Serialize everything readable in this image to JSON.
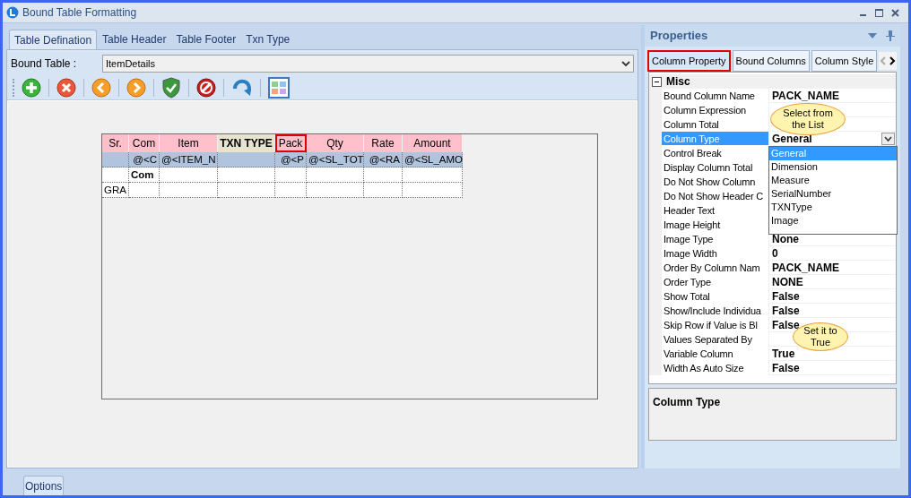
{
  "window": {
    "title": "Bound Table Formatting"
  },
  "tabs": [
    {
      "label": "Table Defination",
      "selected": true
    },
    {
      "label": "Table Header",
      "selected": false
    },
    {
      "label": "Table Footer",
      "selected": false
    },
    {
      "label": "Txn Type",
      "selected": false
    }
  ],
  "bound_table": {
    "label": "Bound Table :",
    "value": "ItemDetails"
  },
  "designer_table": {
    "columns": [
      {
        "label": "Sr.",
        "kind": "normal",
        "selected": false
      },
      {
        "label": "Com",
        "kind": "normal",
        "selected": false
      },
      {
        "label": "Item",
        "kind": "normal",
        "selected": false
      },
      {
        "label": "TXN TYPE",
        "kind": "txn",
        "selected": false
      },
      {
        "label": "Pack",
        "kind": "normal",
        "selected": true
      },
      {
        "label": "Qty",
        "kind": "normal",
        "selected": false
      },
      {
        "label": "Rate",
        "kind": "normal",
        "selected": false
      },
      {
        "label": "Amount",
        "kind": "normal",
        "selected": false
      }
    ],
    "rows": [
      {
        "kind": "detail",
        "cells": [
          "",
          "@<C",
          "@<ITEM_N",
          "",
          "@<P",
          "@<SL_TOT",
          "@<RA",
          "@<SL_AMO"
        ]
      },
      {
        "kind": "group",
        "cells": [
          "",
          "Com",
          "",
          "",
          "",
          "",
          "",
          ""
        ]
      },
      {
        "kind": "total",
        "cells": [
          "GRA",
          "",
          "",
          "",
          "",
          "",
          "",
          ""
        ]
      }
    ]
  },
  "properties": {
    "title": "Properties",
    "tabs": [
      {
        "label": "Column Property",
        "selected": true
      },
      {
        "label": "Bound Columns",
        "selected": false
      },
      {
        "label": "Column Style",
        "selected": false
      }
    ],
    "category": {
      "label": "Misc",
      "expanded": true
    },
    "rows": [
      {
        "name": "Bound Column Name",
        "value": "PACK_NAME",
        "selected": false
      },
      {
        "name": "Column Expression",
        "selected": false
      },
      {
        "name": "Column Total",
        "selected": false
      },
      {
        "name": "Column Type",
        "value": "General",
        "selected": true
      },
      {
        "name": "Control Break",
        "selected": false
      },
      {
        "name": "Display Column Total",
        "selected": false
      },
      {
        "name": "Do Not Show Column",
        "selected": false
      },
      {
        "name": "Do Not Show Header C",
        "selected": false
      },
      {
        "name": "Header Text",
        "selected": false
      },
      {
        "name": "Image Height",
        "selected": false
      },
      {
        "name": "Image Type",
        "value": "None",
        "selected": false
      },
      {
        "name": "Image Width",
        "value": "0",
        "selected": false
      },
      {
        "name": "Order By Column Nam",
        "value": "PACK_NAME",
        "selected": false
      },
      {
        "name": "Order Type",
        "value": "NONE",
        "selected": false
      },
      {
        "name": "Show Total",
        "value": "False",
        "selected": false
      },
      {
        "name": "Show/Include Individua",
        "value": "False",
        "selected": false
      },
      {
        "name": "Skip Row if Value is Bl",
        "value": "False",
        "selected": false
      },
      {
        "name": "Values Separated By",
        "selected": false
      },
      {
        "name": "Variable Column",
        "value": "True",
        "selected": false
      },
      {
        "name": "Width As Auto Size",
        "value": "False",
        "selected": false
      }
    ],
    "dropdown": {
      "options": [
        {
          "label": "General",
          "selected": true
        },
        {
          "label": "Dimension",
          "selected": false
        },
        {
          "label": "Measure",
          "selected": false
        },
        {
          "label": "SerialNumber",
          "selected": false
        },
        {
          "label": "TXNType",
          "selected": false
        },
        {
          "label": "Image",
          "selected": false
        }
      ]
    },
    "callouts": [
      {
        "text": "Select from the List"
      },
      {
        "text": "Set it to True"
      }
    ],
    "description": {
      "title": "Column Type"
    }
  },
  "footer_tabs": [
    {
      "label": "Options"
    }
  ]
}
